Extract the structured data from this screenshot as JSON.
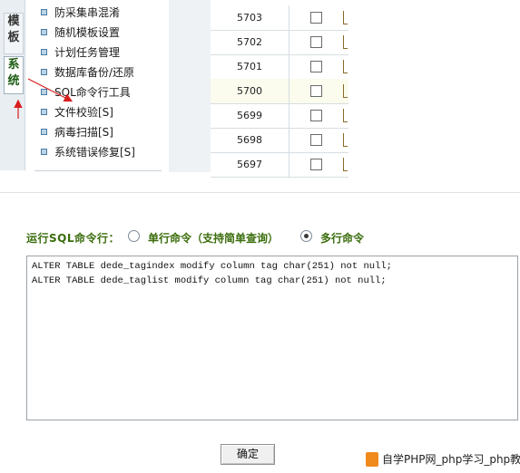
{
  "side_tabs": [
    {
      "label": "模板"
    },
    {
      "label": "系统"
    }
  ],
  "menu": {
    "items": [
      {
        "label": "防采集串混淆"
      },
      {
        "label": "随机模板设置"
      },
      {
        "label": "计划任务管理"
      },
      {
        "label": "数据库备份/还原"
      },
      {
        "label": "SQL命令行工具"
      },
      {
        "label": "文件校验[S]"
      },
      {
        "label": "病毒扫描[S]"
      },
      {
        "label": "系统错误修复[S]"
      }
    ]
  },
  "table": {
    "rows": [
      {
        "id": "5703"
      },
      {
        "id": "5702"
      },
      {
        "id": "5701"
      },
      {
        "id": "5700"
      },
      {
        "id": "5699"
      },
      {
        "id": "5698"
      },
      {
        "id": "5697"
      }
    ]
  },
  "sql_form": {
    "label": "运行SQL命令行：",
    "option_single": "单行命令（支持简单查询）",
    "option_multi": "多行命令",
    "selected": "multi",
    "query": "ALTER TABLE dede_tagindex modify column tag char(251) not null;\nALTER TABLE dede_taglist modify column tag char(251) not null;",
    "submit_label": "确定"
  },
  "watermark": {
    "text": "自学PHP网_php学习_php教"
  },
  "colors": {
    "accent_green": "#3a6d0c",
    "arrow_red": "#d81e1e"
  }
}
